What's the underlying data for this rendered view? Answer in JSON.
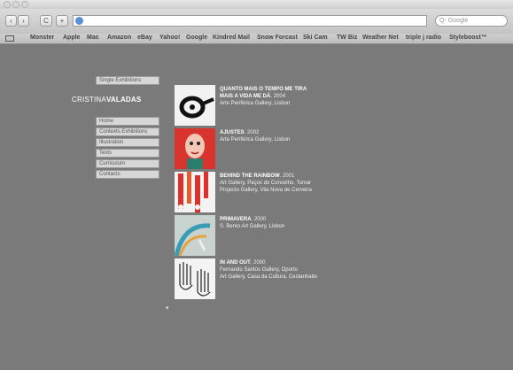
{
  "browser": {
    "search_placeholder": "Q- Google",
    "nav": {
      "back": "‹",
      "forward": "›",
      "reload": "C",
      "add": "+"
    },
    "bookmarks": [
      "Monster",
      "Apple",
      "Mac",
      "Amazon",
      "eBay",
      "Yahoo!",
      "Google",
      "Kindred Mail",
      "Snow Forcast",
      "Ski Cam",
      "TW Biz",
      "Weather Net",
      "triple j radio",
      "Styleboost™"
    ]
  },
  "site": {
    "top_button": "Single Exhibitions",
    "logo_first": "CRISTINA",
    "logo_last": "VALADAS",
    "menu": [
      "Home",
      "Contexts.Exhibitions",
      "Illustration",
      "Texts",
      "Curriculum",
      "Contacts"
    ]
  },
  "exhibitions": [
    {
      "title": "QUANTO MAIS O TEMPO ME TIRA",
      "title2": "MAIS A VIDA ME DÁ",
      "year": ". 2004",
      "lines": [
        "Arte Periférica Gallery, Lisbon"
      ]
    },
    {
      "title": "AJUSTES",
      "title2": "",
      "year": ". 2002",
      "lines": [
        "Arte Periférica Gallery, Lisbon"
      ]
    },
    {
      "title": "BEHIND THE RAINBOW",
      "title2": "",
      "year": ". 2001",
      "lines": [
        "Art Gallery, Paços do Concelho, Tomar",
        "Projecto Gallery, Vila Nova de Cerveira"
      ]
    },
    {
      "title": "PRIMAVERA",
      "title2": "",
      "year": ". 2000",
      "lines": [
        "S. Bento Art Gallery, Lisbon"
      ]
    },
    {
      "title": "IN AND OUT",
      "title2": "",
      "year": ". 2000",
      "lines": [
        "Fernando Santos Gallery, Oporto",
        "Art Gallery, Casa da Cultura, Cestanhaite"
      ]
    }
  ],
  "icons": {
    "down_arrow": "arrow-down-icon"
  }
}
